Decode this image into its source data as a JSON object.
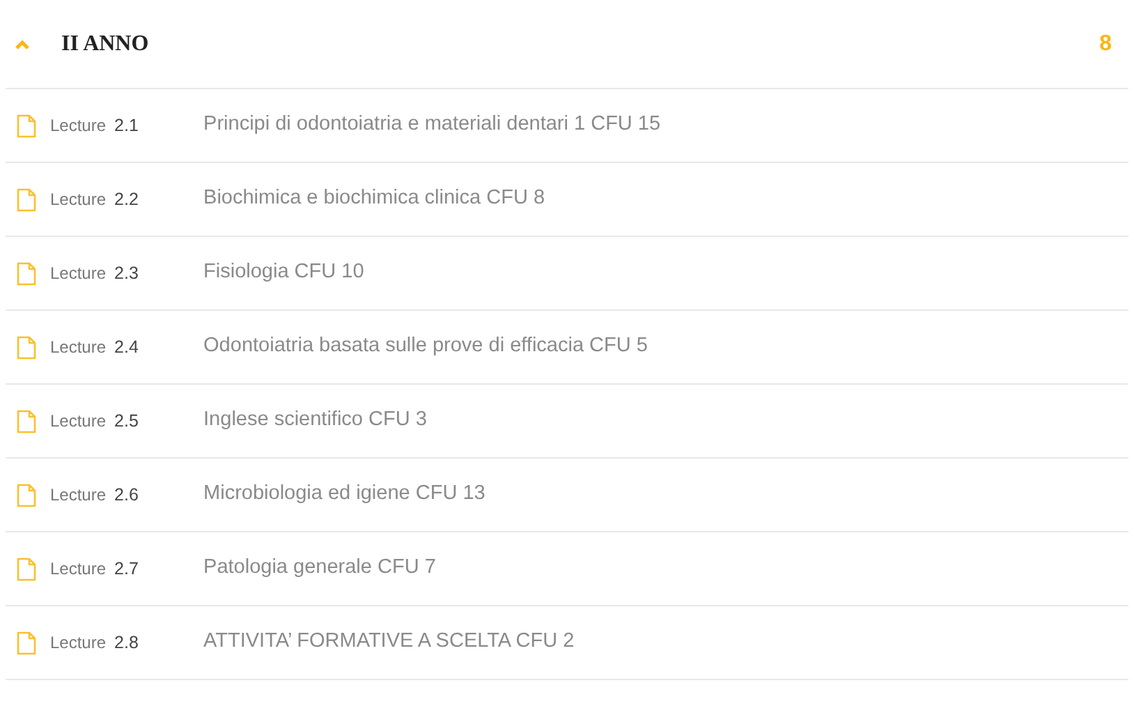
{
  "section": {
    "title": "II ANNO",
    "count": "8",
    "expanded": true
  },
  "lectures": [
    {
      "label": "Lecture",
      "number": "2.1",
      "title": "Principi di odontoiatria e materiali dentari 1 CFU 15"
    },
    {
      "label": "Lecture",
      "number": "2.2",
      "title": "Biochimica e biochimica clinica CFU 8"
    },
    {
      "label": "Lecture",
      "number": "2.3",
      "title": "Fisiologia CFU 10"
    },
    {
      "label": "Lecture",
      "number": "2.4",
      "title": "Odontoiatria basata sulle prove di efficacia CFU 5"
    },
    {
      "label": "Lecture",
      "number": "2.5",
      "title": "Inglese scientifico CFU 3"
    },
    {
      "label": "Lecture",
      "number": "2.6",
      "title": "Microbiologia ed igiene CFU 13"
    },
    {
      "label": "Lecture",
      "number": "2.7",
      "title": "Patologia generale CFU 7"
    },
    {
      "label": "Lecture",
      "number": "2.8",
      "title": "ATTIVITA’ FORMATIVE A SCELTA CFU 2"
    }
  ]
}
